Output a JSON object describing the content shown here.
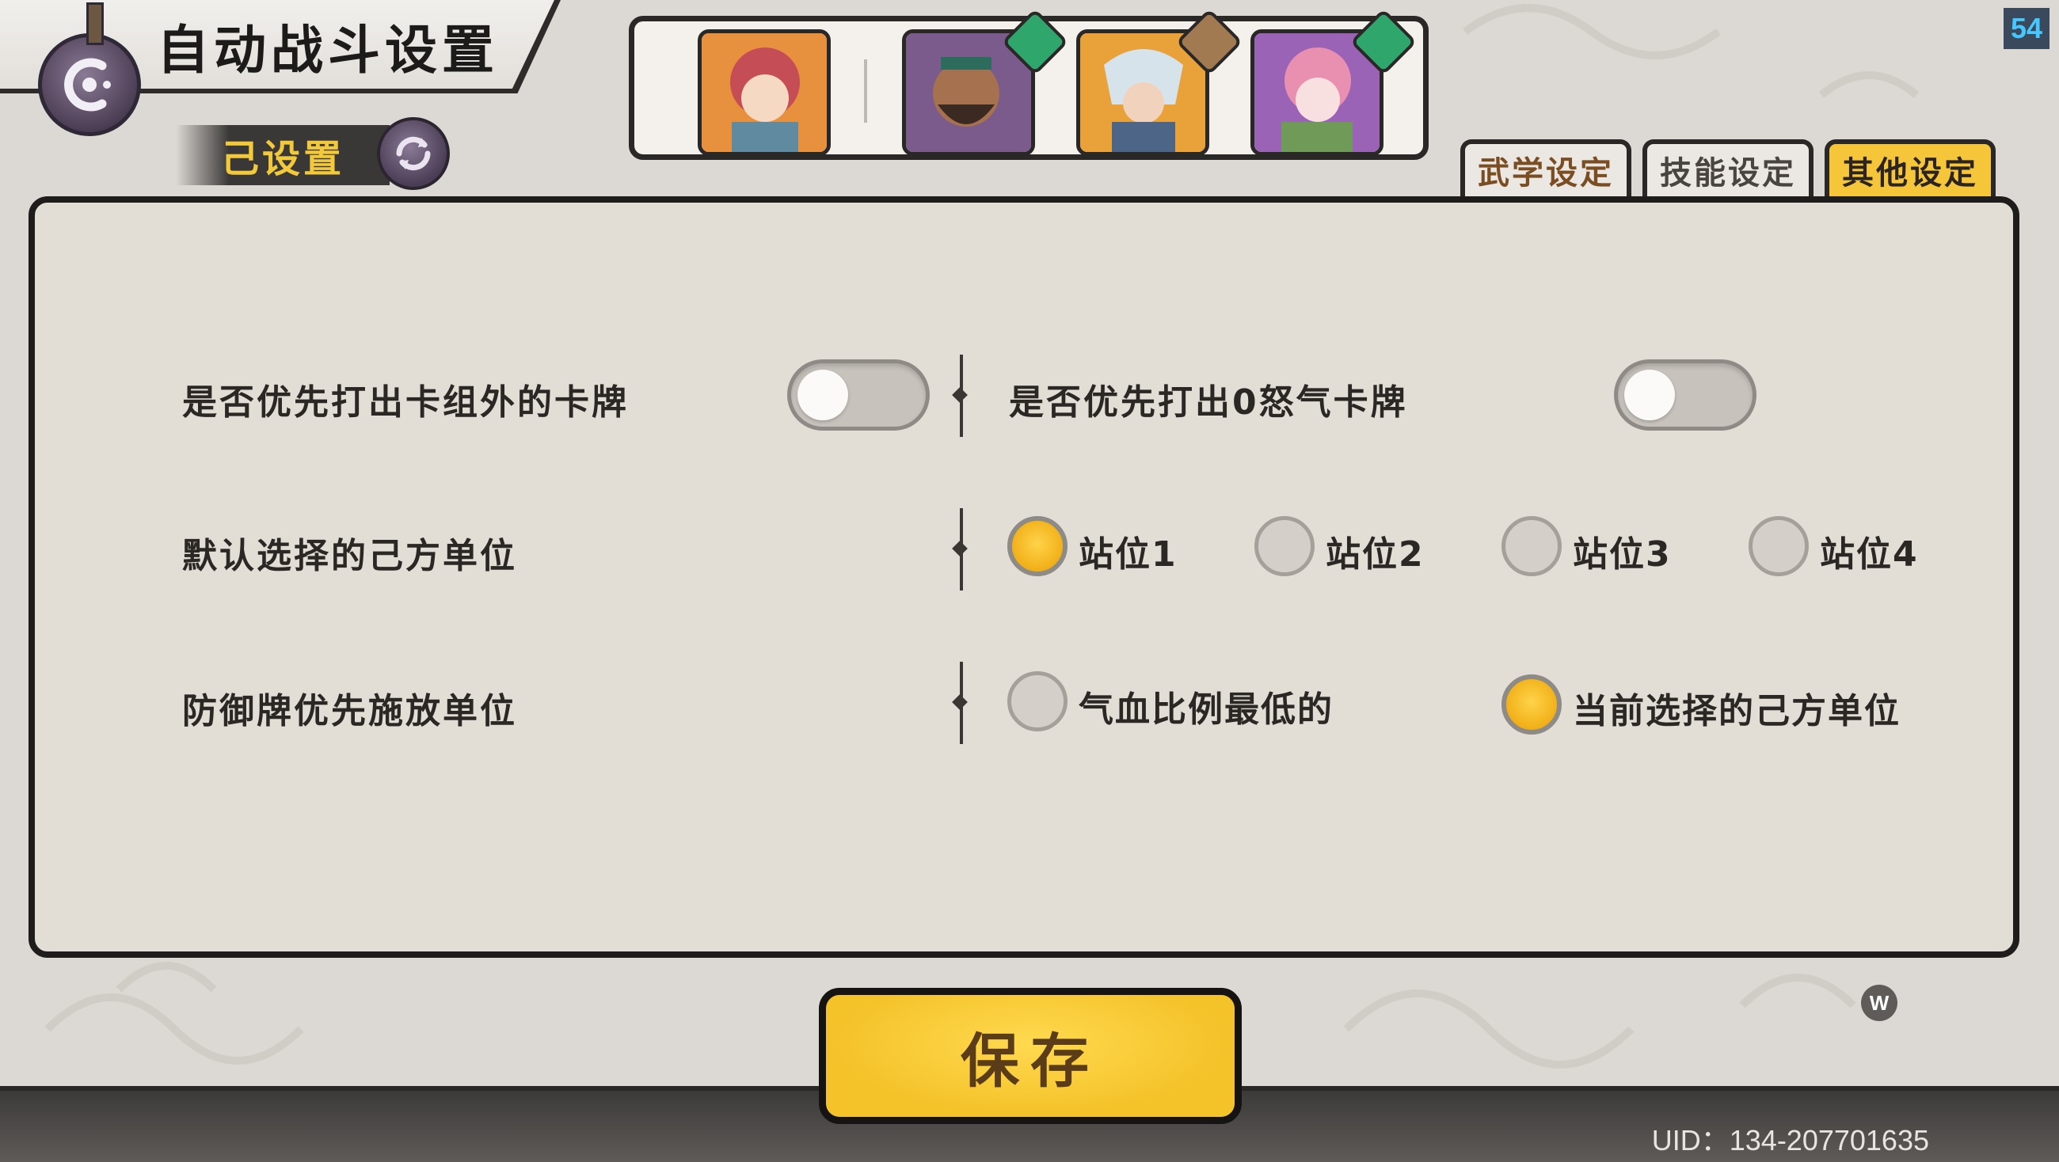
{
  "header": {
    "title": "自动战斗设置",
    "preset_label": "己设置"
  },
  "heroes": [
    {
      "name": "hero-1",
      "badge": "",
      "colors": [
        "#e58c3a",
        "#c2484c"
      ]
    },
    {
      "name": "hero-2",
      "badge": "shield-icon",
      "colors": [
        "#7b5a8c",
        "#3f2f3a"
      ]
    },
    {
      "name": "hero-3",
      "badge": "sword-icon",
      "colors": [
        "#e9a13a",
        "#5b6f8e"
      ]
    },
    {
      "name": "hero-4",
      "badge": "gourd-icon",
      "colors": [
        "#9a63b5",
        "#e29cb6"
      ]
    }
  ],
  "tabs": [
    {
      "label": "武学设定",
      "active": false
    },
    {
      "label": "技能设定",
      "active": false
    },
    {
      "label": "其他设定",
      "active": true
    }
  ],
  "settings": {
    "row1": {
      "left_label": "是否优先打出卡组外的卡牌",
      "left_toggle": false,
      "right_label": "是否优先打出0怒气卡牌",
      "right_toggle": false
    },
    "row2": {
      "label": "默认选择的己方单位",
      "options": [
        "站位1",
        "站位2",
        "站位3",
        "站位4"
      ],
      "selected": "站位1"
    },
    "row3": {
      "label": "防御牌优先施放单位",
      "options": [
        "气血比例最低的",
        "当前选择的己方单位"
      ],
      "selected": "当前选择的己方单位"
    }
  },
  "save_label": "保存",
  "uid": "UID：134-207701635",
  "fps": "54",
  "w_badge": "W",
  "colors": {
    "accent": "#f5c53a",
    "panel": "#e2ddd5",
    "border": "#1f1d1c",
    "fps_text": "#46c8ff"
  }
}
